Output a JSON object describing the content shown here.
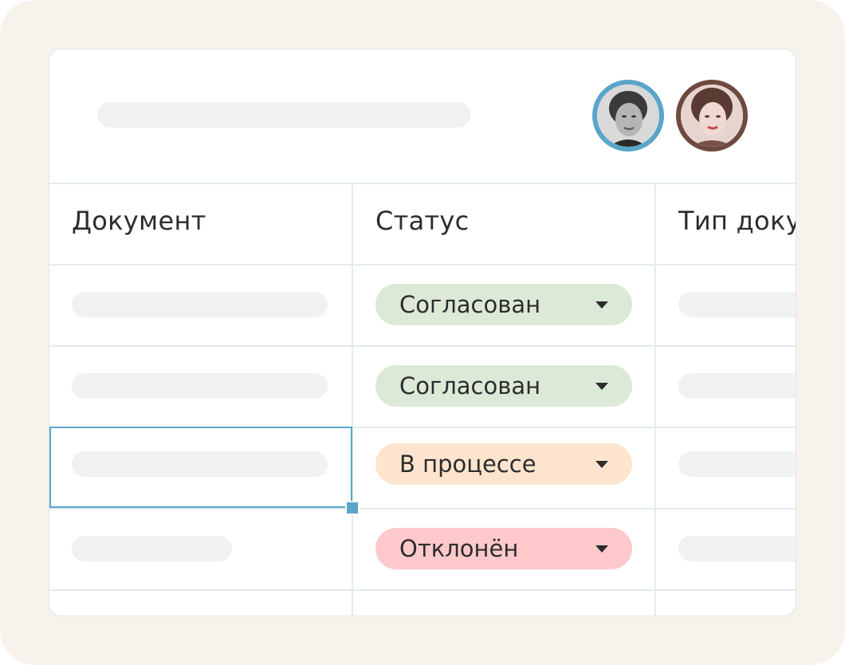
{
  "colors": {
    "background": "#f7f2ec",
    "accent": "#5aa5c9",
    "status_approved": "#dce9d6",
    "status_in_progress": "#fde4cf",
    "status_rejected": "#ffc9cc"
  },
  "header": {
    "collaborators": [
      {
        "icon": "avatar-photo",
        "ring_color": "#5aa5c9"
      },
      {
        "icon": "avatar-photo",
        "ring_color": "#6e4a3e"
      }
    ]
  },
  "table": {
    "columns": [
      "Документ",
      "Статус",
      "Тип доку"
    ],
    "rows": [
      {
        "status": "Согласован",
        "status_color": "#dce9d6"
      },
      {
        "status": "Согласован",
        "status_color": "#dce9d6"
      },
      {
        "status": "В процессе",
        "status_color": "#fde4cf"
      },
      {
        "status": "Отклонён",
        "status_color": "#ffc9cc"
      }
    ],
    "selected_row": 3
  },
  "icons": {
    "dropdown": "chevron-down-icon"
  }
}
